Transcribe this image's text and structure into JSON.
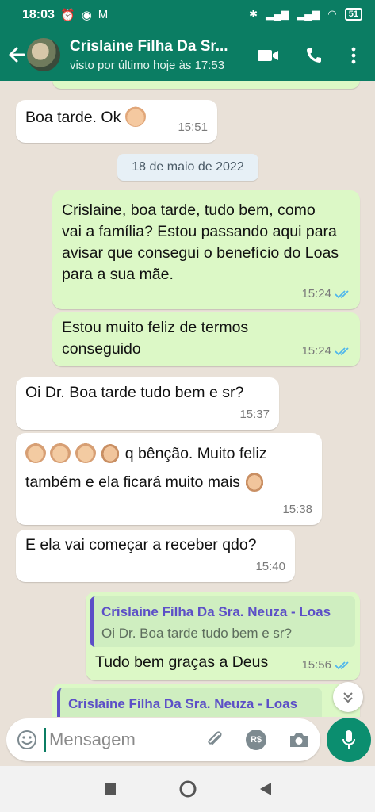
{
  "status_bar": {
    "time": "18:03",
    "battery": "51"
  },
  "header": {
    "contact_name": "Crislaine Filha Da Sr...",
    "last_seen": "visto por último hoje às 17:53"
  },
  "chat": {
    "date_divider": "18 de maio de 2022",
    "messages": [
      {
        "direction": "in",
        "text": "Boa tarde. Ok",
        "emoji": "thumbs-up",
        "time": "15:51"
      },
      {
        "direction": "out",
        "text": "Crislaine, boa tarde, tudo bem, como vai a família? Estou passando aqui para avisar que consegui o benefício do Loas para a sua mãe.",
        "time": "15:24",
        "status": "read"
      },
      {
        "direction": "out",
        "text": "Estou muito feliz de termos conseguido",
        "time": "15:24",
        "status": "read"
      },
      {
        "direction": "in",
        "text": "Oi Dr. Boa tarde tudo bem e sr?",
        "time": "15:37"
      },
      {
        "direction": "in",
        "text_line1": "q bênção. Muito feliz",
        "text_line2": "também  e ela ficará muito mais",
        "time": "15:38"
      },
      {
        "direction": "in",
        "text": "E ela vai começar a receber qdo?",
        "time": "15:40"
      },
      {
        "direction": "out",
        "quote_name": "Crislaine Filha Da Sra. Neuza - Loas",
        "quote_text": "Oi Dr. Boa tarde tudo bem e sr?",
        "text": "Tudo bem graças a Deus",
        "time": "15:56",
        "status": "read"
      },
      {
        "direction": "out",
        "quote_name": "Crislaine Filha Da Sra. Neuza - Loas"
      }
    ]
  },
  "input": {
    "placeholder": "Mensagem",
    "currency_label": "R$"
  },
  "colors": {
    "header": "#0b7d63",
    "outgoing_bubble": "#dcf8c6",
    "incoming_bubble": "#ffffff",
    "read_ticks": "#4fb6ec",
    "quote_accent": "#5c4fc7"
  }
}
